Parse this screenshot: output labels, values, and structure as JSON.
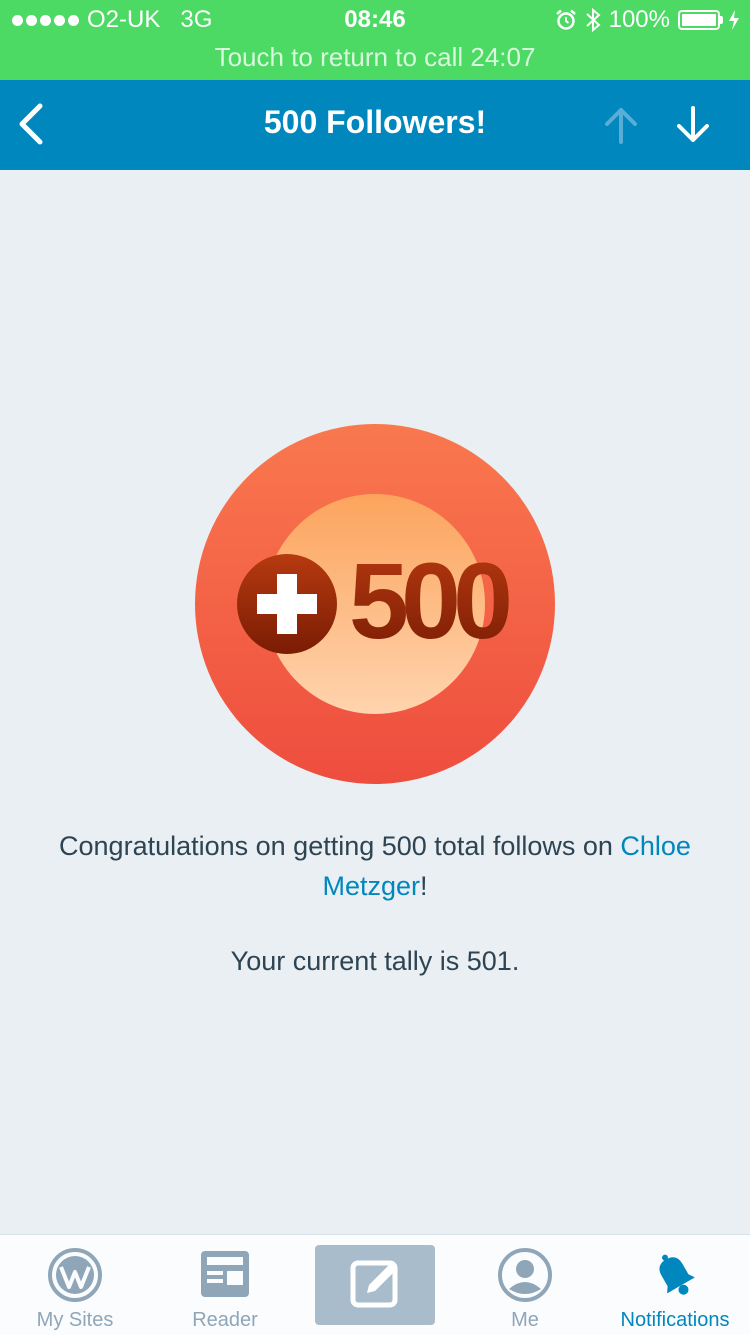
{
  "status_bar": {
    "carrier": "O2-UK",
    "network": "3G",
    "time": "08:46",
    "battery": "100%",
    "call_banner": "Touch to return to call 24:07"
  },
  "nav": {
    "title": "500 Followers!",
    "back_icon": "chevron-left-icon",
    "up_icon": "arrow-up-icon",
    "down_icon": "arrow-down-icon"
  },
  "badge": {
    "label": "500",
    "icon": "plus-500-badge"
  },
  "message": {
    "prefix": "Congratulations on getting 500 total follows on ",
    "link": "Chloe Metzger",
    "suffix": "!",
    "tally": "Your current tally is 501."
  },
  "tabs": [
    {
      "label": "My Sites",
      "icon": "wordpress-icon"
    },
    {
      "label": "Reader",
      "icon": "reader-icon"
    },
    {
      "label": "",
      "icon": "compose-icon"
    },
    {
      "label": "Me",
      "icon": "person-icon"
    },
    {
      "label": "Notifications",
      "icon": "bell-icon"
    }
  ],
  "colors": {
    "status_bar": "#4cd964",
    "nav_bar": "#0087be",
    "background": "#e9eff3",
    "link": "#0087be"
  }
}
